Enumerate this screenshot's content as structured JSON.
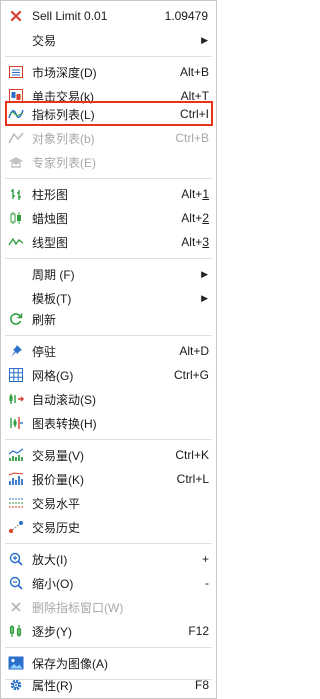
{
  "menu": {
    "sell_limit_label": "Sell Limit 0.01",
    "sell_limit_price": "1.09479",
    "trading_label": "交易",
    "market_depth_label": "市场深度(D)",
    "market_depth_shortcut": "Alt+B",
    "one_click_trading_label": "单击交易(k)",
    "one_click_trading_shortcut": "Alt+T",
    "indicators_list_label": "指标列表(L)",
    "indicators_list_shortcut": "Ctrl+I",
    "objects_list_label": "对象列表(b)",
    "objects_list_shortcut": "Ctrl+B",
    "experts_list_label": "专家列表(E)",
    "bar_chart_label": "柱形图",
    "bar_chart_shortcut_prefix": "Alt+",
    "bar_chart_shortcut_key": "1",
    "candlesticks_label": "蜡烛图",
    "candlesticks_shortcut_prefix": "Alt+",
    "candlesticks_shortcut_key": "2",
    "line_chart_label": "线型图",
    "line_chart_shortcut_prefix": "Alt+",
    "line_chart_shortcut_key": "3",
    "timeframes_label": "周期 (F)",
    "templates_label": "模板(T)",
    "refresh_label": "刷新",
    "dock_label": "停驻",
    "dock_shortcut": "Alt+D",
    "grid_label": "网格(G)",
    "grid_shortcut": "Ctrl+G",
    "auto_scroll_label": "自动滚动(S)",
    "chart_shift_label": "图表转换(H)",
    "volumes_label": "交易量(V)",
    "volumes_shortcut": "Ctrl+K",
    "ask_line_label": "报价量(K)",
    "ask_line_shortcut": "Ctrl+L",
    "trade_levels_label": "交易水平",
    "trade_history_label": "交易历史",
    "zoom_in_label": "放大(I)",
    "zoom_in_shortcut": "+",
    "zoom_out_label": "缩小(O)",
    "zoom_out_shortcut": "-",
    "delete_indicator_window_label": "删除指标窗口(W)",
    "step_label": "逐步(Y)",
    "step_shortcut": "F12",
    "save_as_picture_label": "保存为图像(A)",
    "properties_label": "属性(R)",
    "properties_shortcut": "F8"
  },
  "colors": {
    "highlight_border": "#e8331a",
    "disabled_text": "#a8a8a8",
    "icon_blue": "#2a6fc9",
    "icon_green": "#2e9e3e",
    "icon_red": "#d9402b"
  }
}
